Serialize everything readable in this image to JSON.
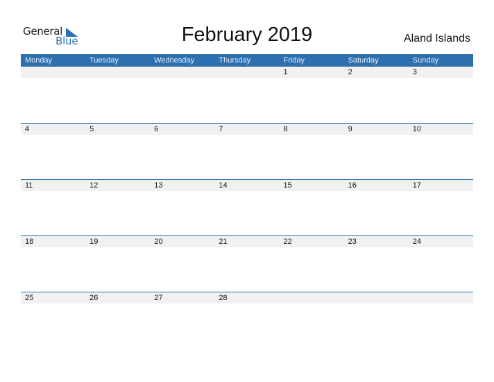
{
  "logo": {
    "word1": "General",
    "word2": "Blue"
  },
  "header": {
    "title": "February 2019",
    "country": "Aland Islands"
  },
  "weekdays": [
    "Monday",
    "Tuesday",
    "Wednesday",
    "Thursday",
    "Friday",
    "Saturday",
    "Sunday"
  ],
  "weeks": [
    [
      "",
      "",
      "",
      "",
      "1",
      "2",
      "3"
    ],
    [
      "4",
      "5",
      "6",
      "7",
      "8",
      "9",
      "10"
    ],
    [
      "11",
      "12",
      "13",
      "14",
      "15",
      "16",
      "17"
    ],
    [
      "18",
      "19",
      "20",
      "21",
      "22",
      "23",
      "24"
    ],
    [
      "25",
      "26",
      "27",
      "28",
      "",
      "",
      ""
    ]
  ],
  "colors": {
    "accent": "#2e6fb0",
    "band": "#f1f1f1"
  }
}
